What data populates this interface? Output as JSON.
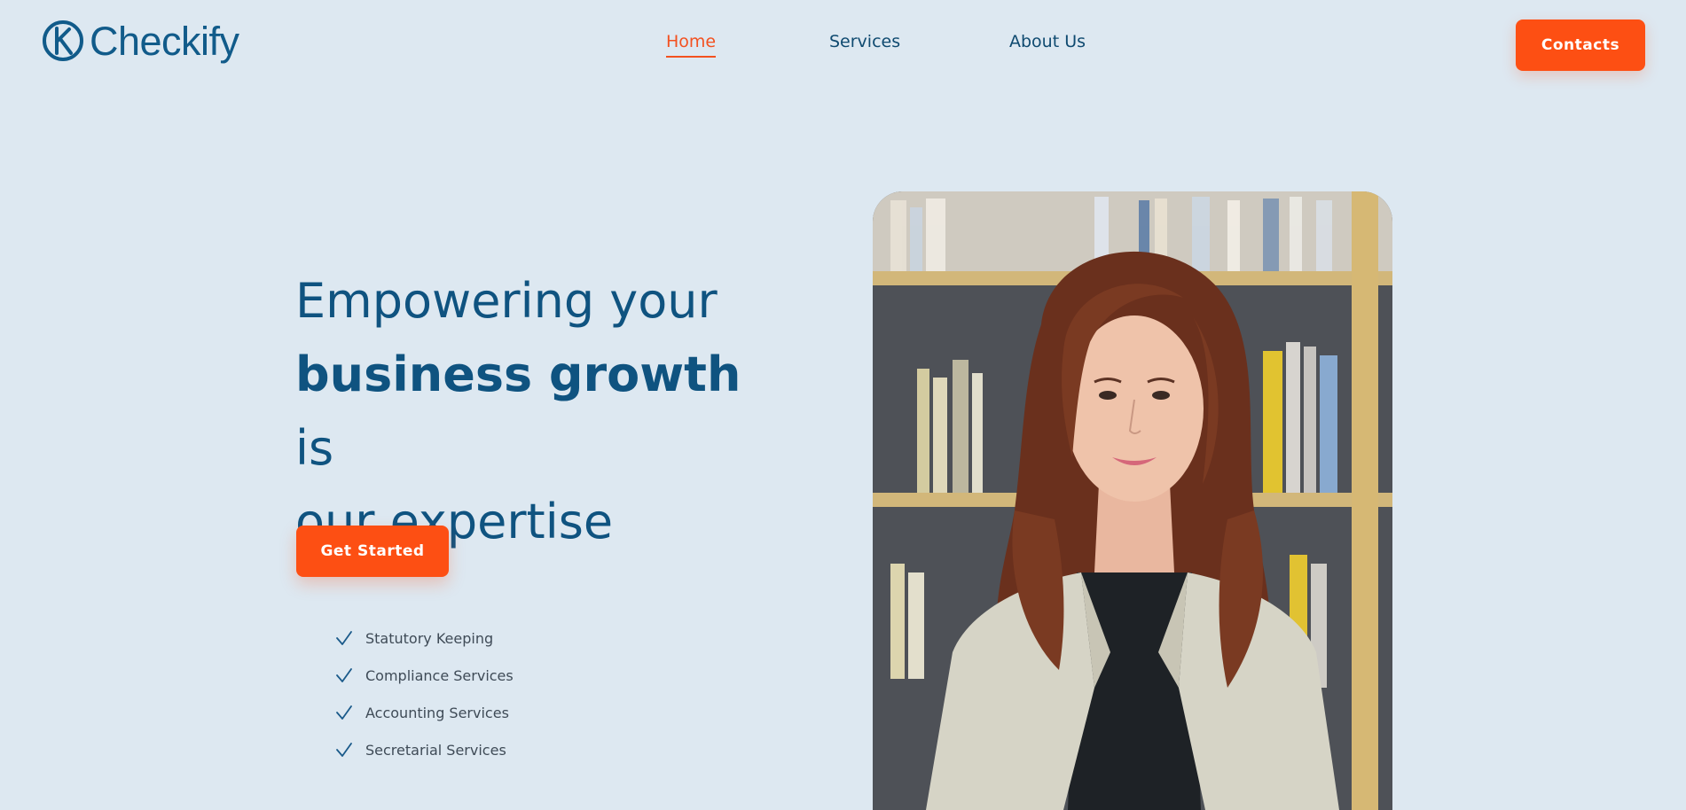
{
  "brand": {
    "name": "Checkify",
    "logo_icon": "k-circle-icon"
  },
  "nav": {
    "items": [
      {
        "label": "Home",
        "active": true
      },
      {
        "label": "Services",
        "active": false
      },
      {
        "label": "About Us",
        "active": false
      }
    ],
    "contact_label": "Contacts"
  },
  "hero": {
    "headline_line1": "Empowering your",
    "headline_bold": "business growth",
    "headline_after_bold": " is",
    "headline_line3": "our expertise",
    "cta_label": "Get Started",
    "features": [
      {
        "label": "Statutory Keeping",
        "icon": "check-icon"
      },
      {
        "label": "Compliance Services",
        "icon": "check-icon"
      },
      {
        "label": "Accounting Services",
        "icon": "check-icon"
      },
      {
        "label": "Secretarial Services",
        "icon": "check-icon"
      }
    ],
    "image": "professional woman in front of bookshelf"
  },
  "colors": {
    "background": "#dde8f1",
    "primary_text": "#0f5380",
    "accent": "#fd4f13"
  }
}
